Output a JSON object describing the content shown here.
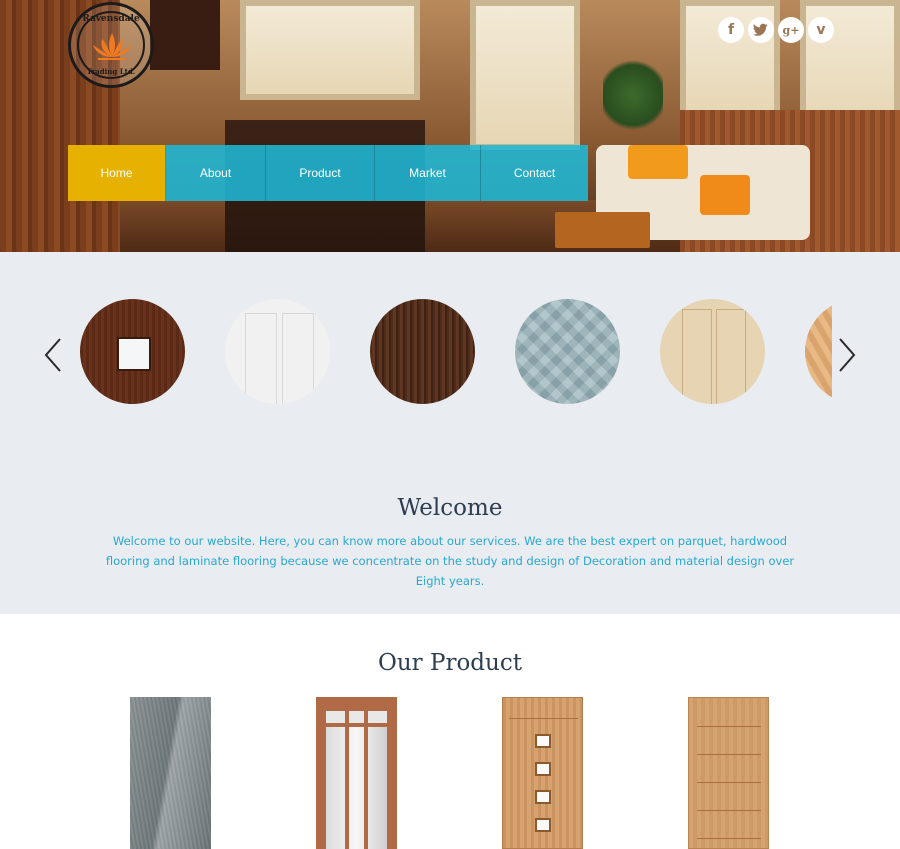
{
  "logo": {
    "top_text": "Ravensdale",
    "bottom_text": "Trading Ltd."
  },
  "social": [
    {
      "icon": "facebook-icon",
      "glyph": "f"
    },
    {
      "icon": "twitter-icon",
      "glyph": "t"
    },
    {
      "icon": "google-plus-icon",
      "glyph": "g+"
    },
    {
      "icon": "vimeo-icon",
      "glyph": "v"
    }
  ],
  "nav": {
    "items": [
      {
        "label": "Home",
        "active": true
      },
      {
        "label": "About",
        "active": false
      },
      {
        "label": "Product",
        "active": false
      },
      {
        "label": "Market",
        "active": false
      },
      {
        "label": "Contact",
        "active": false
      }
    ]
  },
  "carousel": {
    "prev_icon": "chevron-left-icon",
    "next_icon": "chevron-right-icon",
    "swatches": [
      "dark-walnut-door-with-window",
      "white-panel-door",
      "dark-brown-wood",
      "grey-herringbone-parquet",
      "light-oak-panel-door",
      "oak-veneer"
    ]
  },
  "welcome": {
    "title": "Welcome",
    "text": "Welcome to our website. Here, you can know more about our services. We are the best expert on parquet, hardwood flooring and laminate flooring because we concentrate on the study and design of Decoration and material design over Eight years."
  },
  "products": {
    "title": "Our Product",
    "items": [
      "grey-chevron-door",
      "mahogany-glazed-door",
      "oak-four-pane-door",
      "oak-horizontal-rail-door"
    ]
  },
  "colors": {
    "nav": "#1fb8d6",
    "nav_active": "#e6b100",
    "accent_text": "#27a9cf",
    "heading": "#2d3e50",
    "band_bg": "#e9ecf1"
  }
}
